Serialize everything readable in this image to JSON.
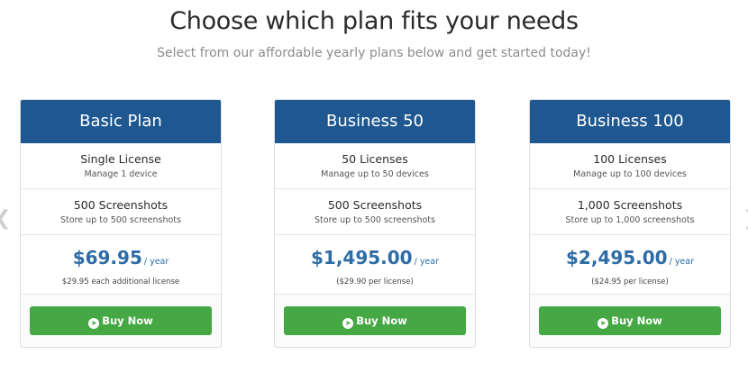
{
  "header": {
    "title": "Choose which plan fits your needs",
    "subtitle": "Select from our affordable yearly plans below and get started today!"
  },
  "nav": {
    "prev_icon": "chevron-left-icon",
    "next_icon": "chevron-right-icon"
  },
  "colors": {
    "header_bg": "#1f5891",
    "price": "#2d6ca5",
    "button": "#45a844"
  },
  "plans": [
    {
      "name": "Basic Plan",
      "features": [
        {
          "title": "Single License",
          "desc": "Manage 1 device"
        },
        {
          "title": "500 Screenshots",
          "desc": "Store up to 500 screenshots"
        }
      ],
      "price": "$69.95",
      "period": "/ year",
      "note": "$29.95 each additional license",
      "button": "Buy Now",
      "button_icon": "arrow-circle-right-icon"
    },
    {
      "name": "Business 50",
      "features": [
        {
          "title": "50 Licenses",
          "desc": "Manage up to 50 devices"
        },
        {
          "title": "500 Screenshots",
          "desc": "Store up to 500 screenshots"
        }
      ],
      "price": "$1,495.00",
      "period": "/ year",
      "note": "($29.90 per license)",
      "button": "Buy Now",
      "button_icon": "arrow-circle-right-icon"
    },
    {
      "name": "Business 100",
      "features": [
        {
          "title": "100 Licenses",
          "desc": "Manage up to 100 devices"
        },
        {
          "title": "1,000 Screenshots",
          "desc": "Store up to 1,000 screenshots"
        }
      ],
      "price": "$2,495.00",
      "period": "/ year",
      "note": "($24.95 per license)",
      "button": "Buy Now",
      "button_icon": "arrow-circle-right-icon"
    }
  ]
}
